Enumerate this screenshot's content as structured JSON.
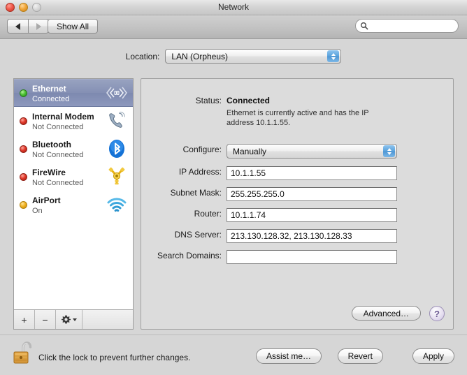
{
  "window": {
    "title": "Network"
  },
  "toolbar": {
    "back_icon": "triangle-left-icon",
    "forward_icon": "triangle-right-icon",
    "show_all_label": "Show All",
    "search_placeholder": "",
    "search_value": "",
    "search_icon": "search-icon"
  },
  "location": {
    "label": "Location:",
    "selected": "LAN (Orpheus)"
  },
  "sidebar": {
    "interfaces": [
      {
        "name": "Ethernet",
        "status": "Connected",
        "dot": "green",
        "icon": "ethernet-icon",
        "selected": true
      },
      {
        "name": "Internal Modem",
        "status": "Not Connected",
        "dot": "red",
        "icon": "modem-icon",
        "selected": false
      },
      {
        "name": "Bluetooth",
        "status": "Not Connected",
        "dot": "red",
        "icon": "bluetooth-icon",
        "selected": false
      },
      {
        "name": "FireWire",
        "status": "Not Connected",
        "dot": "red",
        "icon": "firewire-icon",
        "selected": false
      },
      {
        "name": "AirPort",
        "status": "On",
        "dot": "amber",
        "icon": "airport-wifi-icon",
        "selected": false
      }
    ],
    "footer": {
      "add_label": "+",
      "remove_label": "−",
      "action_icon": "gear-icon"
    }
  },
  "panel": {
    "status_label": "Status:",
    "status_value": "Connected",
    "status_description": "Ethernet is currently active and has the IP address 10.1.1.55.",
    "configure_label": "Configure:",
    "configure_value": "Manually",
    "fields": [
      {
        "label": "IP Address:",
        "value": "10.1.1.55"
      },
      {
        "label": "Subnet Mask:",
        "value": "255.255.255.0"
      },
      {
        "label": "Router:",
        "value": "10.1.1.74"
      },
      {
        "label": "DNS Server:",
        "value": "213.130.128.32, 213.130.128.33"
      },
      {
        "label": "Search Domains:",
        "value": ""
      }
    ],
    "advanced_label": "Advanced…",
    "help_label": "?"
  },
  "bottom": {
    "lock_icon": "unlocked-padlock-icon",
    "lock_note": "Click the lock to prevent further changes.",
    "assist_label": "Assist me…",
    "revert_label": "Revert",
    "apply_label": "Apply"
  },
  "colors": {
    "selection_blue": "#8590b4",
    "status_connected_green": "#4fc337",
    "status_disconnected_red": "#e0392b",
    "status_on_amber": "#f0b323",
    "popup_arrow_blue": "#5ba3dd",
    "help_purple": "#6c5a93"
  }
}
